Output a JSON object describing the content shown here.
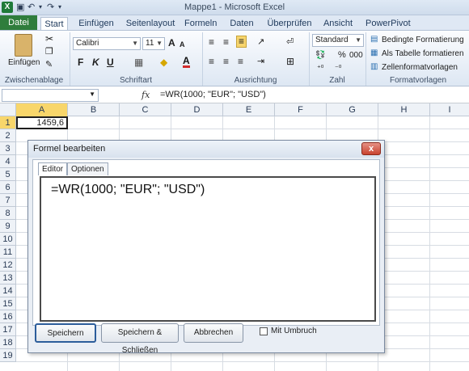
{
  "window": {
    "title": "Mappe1 - Microsoft Excel",
    "logo": "X"
  },
  "quick_access": {
    "undo": "↶",
    "redo": "↷"
  },
  "tabs": [
    {
      "label": "Datei"
    },
    {
      "label": "Start"
    },
    {
      "label": "Einfügen"
    },
    {
      "label": "Seitenlayout"
    },
    {
      "label": "Formeln"
    },
    {
      "label": "Daten"
    },
    {
      "label": "Überprüfen"
    },
    {
      "label": "Ansicht"
    },
    {
      "label": "PowerPivot"
    }
  ],
  "ribbon": {
    "groups": {
      "clipboard": "Zwischenablage",
      "font": "Schriftart",
      "alignment": "Ausrichtung",
      "number": "Zahl",
      "styles": "Formatvorlagen"
    },
    "paste_label": "Einfügen",
    "font_name": "Calibri",
    "font_size": "11",
    "bold": "F",
    "italic": "K",
    "underline": "U",
    "font_grow": "A",
    "font_shrink": "A",
    "font_color_letter": "A",
    "number_format": "Standard",
    "percent": "%",
    "thousands": "000",
    "cond_format": "Bedingte Formatierung",
    "as_table": "Als Tabelle formatieren",
    "cell_styles": "Zellenformatvorlagen"
  },
  "formula_bar": {
    "fx": "fx",
    "content": "=WR(1000; \"EUR\"; \"USD\")"
  },
  "grid": {
    "columns": [
      "A",
      "B",
      "C",
      "D",
      "E",
      "F",
      "G",
      "H",
      "I"
    ],
    "rows": [
      "1",
      "2",
      "3",
      "4",
      "5",
      "6",
      "7",
      "8",
      "9",
      "10",
      "11",
      "12",
      "13",
      "14",
      "15",
      "16",
      "17",
      "18",
      "19"
    ],
    "a1_value": "1459,6"
  },
  "dialog": {
    "title": "Formel bearbeiten",
    "close": "x",
    "tabs": [
      "Editor",
      "Optionen"
    ],
    "editor_text": "=WR(1000; \"EUR\"; \"USD\")",
    "buttons": {
      "save": "Speichern",
      "save_close": "Speichern & Schließen",
      "cancel": "Abbrechen"
    },
    "wrap_label": "Mit Umbruch"
  },
  "colors": {
    "excel_green": "#2f7d3c",
    "close_red": "#c8432f",
    "ribbon_bg": "#dde7f3"
  }
}
